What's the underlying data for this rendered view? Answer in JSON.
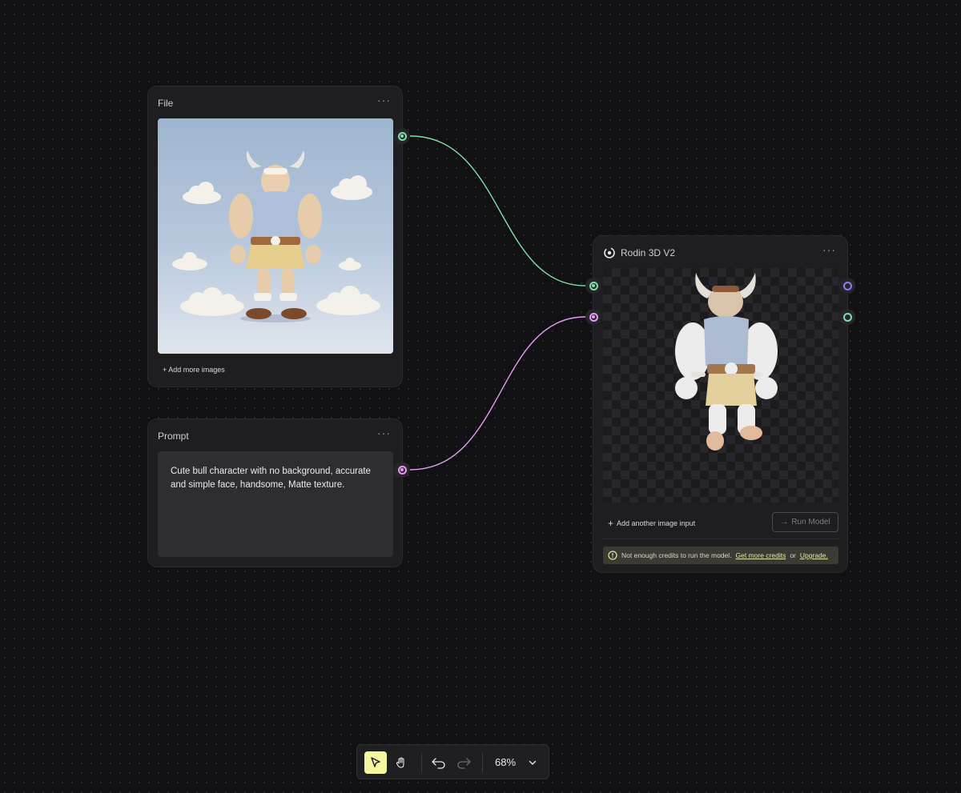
{
  "file_node": {
    "title": "File",
    "menu": "···",
    "add_more_label": "+ Add more images"
  },
  "prompt_node": {
    "title": "Prompt",
    "menu": "···",
    "text": "Cute bull character with no background, accurate and simple face, handsome, Matte texture."
  },
  "rodin_node": {
    "title": "Rodin 3D V2",
    "menu": "···",
    "add_input_label": "Add another image input",
    "run_label": "Run Model",
    "warning_text": "Not enough credits to run the model.",
    "warning_link": "Get more credits",
    "warning_or": "or",
    "warning_upgrade": "Upgrade."
  },
  "toolbar": {
    "zoom": "68%"
  },
  "colors": {
    "edge_image": "#7ee0a8",
    "edge_prompt": "#e59cf0",
    "port_output_3d": "#8f7cf0",
    "highlight": "#f5f7a0"
  },
  "icons": [
    "ellipsis-icon",
    "rodin-logo-icon",
    "plus-icon",
    "arrow-right-icon",
    "warning-circle-icon",
    "cursor-icon",
    "hand-icon",
    "undo-icon",
    "redo-icon",
    "chevron-down-icon"
  ]
}
